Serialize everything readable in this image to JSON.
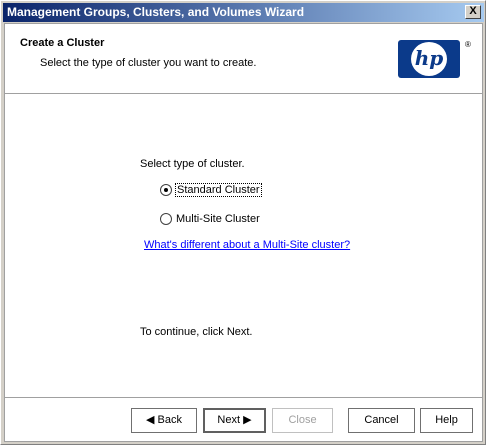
{
  "window": {
    "title": "Management Groups, Clusters, and Volumes Wizard",
    "close_label": "X"
  },
  "header": {
    "title": "Create a Cluster",
    "subtitle": "Select the type of cluster you want to create.",
    "logo_text": "hp",
    "registered": "®"
  },
  "body": {
    "prompt": "Select type of cluster.",
    "options": [
      {
        "label": "Standard Cluster",
        "selected": true
      },
      {
        "label": "Multi-Site Cluster",
        "selected": false
      }
    ],
    "link": "What's different about a Multi-Site cluster?",
    "continue_text": "To continue, click Next."
  },
  "buttons": {
    "back": "Back",
    "next": "Next",
    "close": "Close",
    "cancel": "Cancel",
    "help": "Help"
  }
}
